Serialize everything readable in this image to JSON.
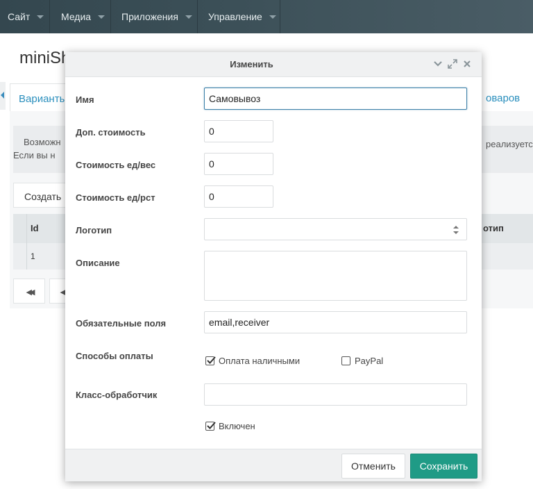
{
  "topnav": {
    "items": [
      {
        "label": "Сайт"
      },
      {
        "label": "Медиа"
      },
      {
        "label": "Приложения"
      },
      {
        "label": "Управление"
      }
    ]
  },
  "background": {
    "page_title": "miniSh",
    "tab_active": "Варианты",
    "tab_right": "оваров",
    "info_line1": "Возможн",
    "info_line2": "Если вы н",
    "info_right": "реализуетс",
    "create_button": "Создать",
    "table": {
      "col_id": "Id",
      "col_logo": "отип",
      "row_id": "1"
    },
    "pager_first": "◀◀",
    "pager_prev": "◀"
  },
  "modal": {
    "title": "Изменить",
    "fields": {
      "name": {
        "label": "Имя",
        "value": "Самовывоз"
      },
      "price": {
        "label": "Доп. стоимость",
        "value": "0"
      },
      "weight_price": {
        "label": "Стоимость ед/вес",
        "value": "0"
      },
      "distance_price": {
        "label": "Стоимость ед/рст",
        "value": "0"
      },
      "logo": {
        "label": "Логотип",
        "value": ""
      },
      "description": {
        "label": "Описание",
        "value": ""
      },
      "required": {
        "label": "Обязательные поля",
        "value": "email,receiver"
      },
      "payments": {
        "label": "Способы оплаты"
      },
      "handler": {
        "label": "Класс-обработчик",
        "value": ""
      }
    },
    "payments": [
      {
        "label": "Оплата наличными",
        "checked": true
      },
      {
        "label": "PayPal",
        "checked": false
      }
    ],
    "enabled": {
      "label": "Включен",
      "checked": true
    },
    "cancel_label": "Отменить",
    "save_label": "Сохранить"
  }
}
